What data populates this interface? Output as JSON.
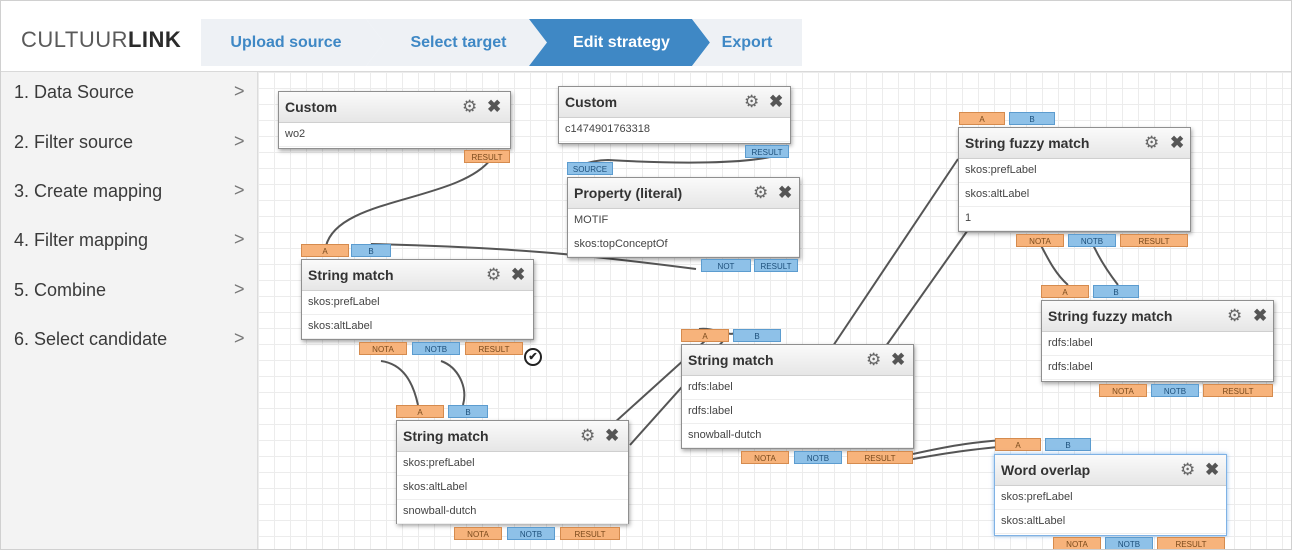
{
  "app": {
    "logo_part1": "CULTUUR",
    "logo_part2": "LINK"
  },
  "steps": [
    {
      "label": "Upload source",
      "active": false
    },
    {
      "label": "Select target",
      "active": false
    },
    {
      "label": "Edit strategy",
      "active": true
    },
    {
      "label": "Export",
      "active": false
    }
  ],
  "sidebar": {
    "items": [
      {
        "label": "1. Data Source"
      },
      {
        "label": "2. Filter source"
      },
      {
        "label": "3. Create mapping"
      },
      {
        "label": "4. Filter mapping"
      },
      {
        "label": "5. Combine"
      },
      {
        "label": "6. Select candidate"
      }
    ],
    "chevron": ">"
  },
  "icons": {
    "gear": "⚙",
    "close": "✖",
    "check": "✔"
  },
  "colors": {
    "accent": "#3f88c5",
    "output_tag": "#f7b37b",
    "input_tag": "#8ec1e8"
  },
  "tags": {
    "a": "A",
    "b": "B",
    "source": "SOURCE",
    "not": "NOT",
    "nota": "NOTA",
    "notb": "NOTB",
    "result": "RESULT"
  },
  "nodes": {
    "custom1": {
      "title": "Custom",
      "rows": [
        "wo2"
      ]
    },
    "custom2": {
      "title": "Custom",
      "rows": [
        "c1474901763318"
      ]
    },
    "property": {
      "title": "Property (literal)",
      "rows": [
        "MOTIF",
        "skos:topConceptOf"
      ]
    },
    "sm1": {
      "title": "String match",
      "rows": [
        "skos:prefLabel",
        "skos:altLabel"
      ]
    },
    "sm2": {
      "title": "String match",
      "rows": [
        "skos:prefLabel",
        "skos:altLabel",
        "snowball-dutch"
      ]
    },
    "sm3": {
      "title": "String match",
      "rows": [
        "rdfs:label",
        "rdfs:label",
        "snowball-dutch"
      ]
    },
    "sfm1": {
      "title": "String fuzzy match",
      "rows": [
        "skos:prefLabel",
        "skos:altLabel",
        "1"
      ]
    },
    "sfm2": {
      "title": "String fuzzy match",
      "rows": [
        "rdfs:label",
        "rdfs:label"
      ]
    },
    "wo": {
      "title": "Word overlap",
      "rows": [
        "skos:prefLabel",
        "skos:altLabel"
      ]
    }
  }
}
